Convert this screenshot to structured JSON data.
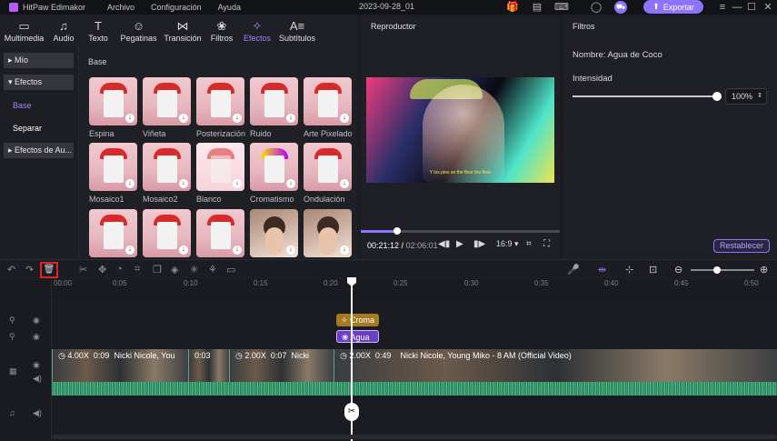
{
  "app": {
    "title": "HitPaw Edimakor",
    "project": "2023-09-28_01"
  },
  "menu": [
    "Archivo",
    "Configuración",
    "Ayuda"
  ],
  "export_label": "Exportar",
  "tool_tabs": [
    {
      "label": "Multimedia",
      "icon": "media-icon"
    },
    {
      "label": "Audio",
      "icon": "music-note-icon"
    },
    {
      "label": "Texto",
      "icon": "text-icon"
    },
    {
      "label": "Pegatinas",
      "icon": "sticker-icon"
    },
    {
      "label": "Transición",
      "icon": "transition-icon"
    },
    {
      "label": "Filtros",
      "icon": "filters-icon"
    },
    {
      "label": "Efectos",
      "icon": "effects-icon",
      "active": true
    },
    {
      "label": "Subtítulos",
      "icon": "subtitles-icon"
    }
  ],
  "categories": {
    "mio": "Mío",
    "efectos": "Efectos",
    "base": "Base",
    "separar": "Separar",
    "audio_effects": "Efectos de Au..."
  },
  "grid": {
    "section_title": "Base",
    "items": [
      "Espina",
      "Viñeta",
      "Posterización",
      "Ruido",
      "Arte Pixelado",
      "Mosaico1",
      "Mosaico2",
      "Blanco",
      "Cromatismo",
      "Ondulación"
    ]
  },
  "player": {
    "title": "Reproductor",
    "subtitle_text": "Y los pies on the floor the floor",
    "current_time": "00:21:12",
    "total_time": "02:06:01",
    "aspect": "16:9",
    "progress_fraction": 0.18
  },
  "filters_panel": {
    "title": "Filtros",
    "name_line": "Nombre: Agua de Coco",
    "intensity_label": "Intensidad",
    "intensity_value": "100%",
    "intensity_fraction": 1.0,
    "reset_label": "Restablecer"
  },
  "timeline": {
    "ruler_ticks": [
      "00:00",
      "0:05",
      "0:10",
      "0:15",
      "0:20",
      "0:25",
      "0:30",
      "0:35",
      "0:40",
      "0:45",
      "0:50"
    ],
    "effect_chip": "Croma",
    "filter_chip": "Agua",
    "clips": [
      {
        "speed": "4.00X",
        "duration": "0:09",
        "name": "Nicki Nicole, You"
      },
      {
        "duration": "0:03"
      },
      {
        "speed": "2.00X",
        "duration": "0:07",
        "name": "Nicki"
      },
      {
        "speed": "2.00X",
        "duration": "0:49",
        "name": "Nicki Nicole, Young Miko - 8 AM (Official Video)"
      }
    ]
  },
  "colors": {
    "accent": "#8e73ff",
    "highlight": "#e0231e",
    "waveform": "#3ea679"
  }
}
